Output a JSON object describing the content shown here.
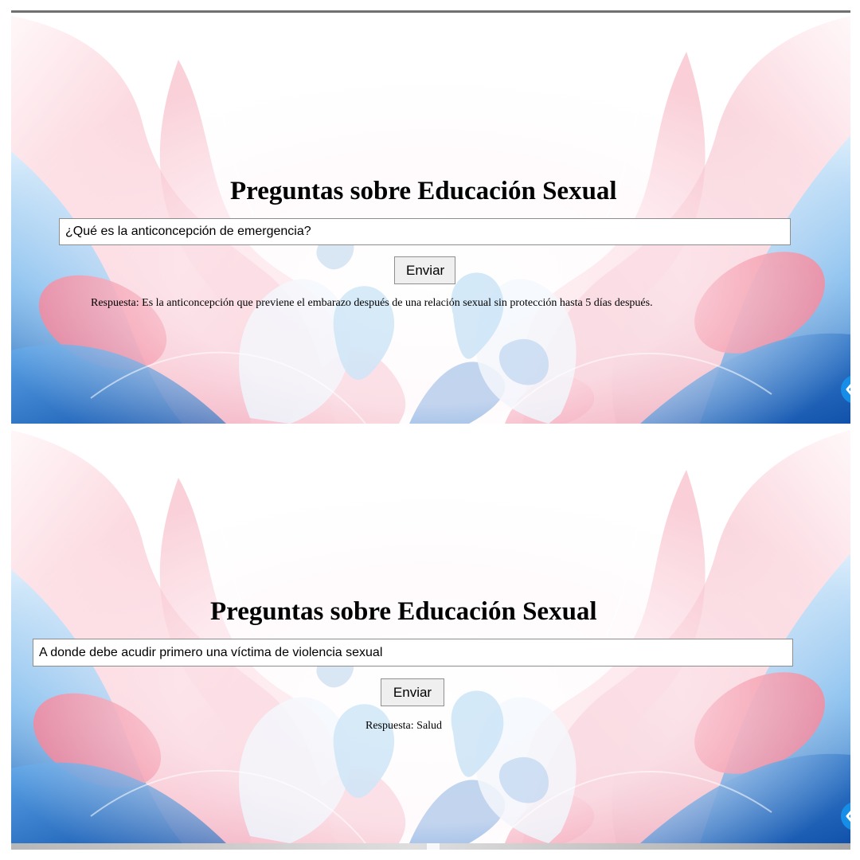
{
  "panels": [
    {
      "title": "Preguntas sobre Educación Sexual",
      "question": {
        "value": "¿Qué es la anticoncepción de emergencia?",
        "placeholder": ""
      },
      "button_label": "Enviar",
      "answer": "Respuesta: Es la anticoncepción que previene el embarazo después de una relación sexual sin protección hasta 5 días después."
    },
    {
      "title": "Preguntas sobre Educación Sexual",
      "question": {
        "value": "A donde debe acudir primero una víctima de violencia sexual",
        "placeholder": ""
      },
      "button_label": "Enviar",
      "answer": "Respuesta: Salud"
    }
  ],
  "icons": {
    "side_tab": "chevron-left-icon"
  },
  "colors": {
    "pink": "#f48aa2",
    "blue": "#1b71c7",
    "light_blue": "#8fd0f2",
    "button": "#efefef"
  }
}
